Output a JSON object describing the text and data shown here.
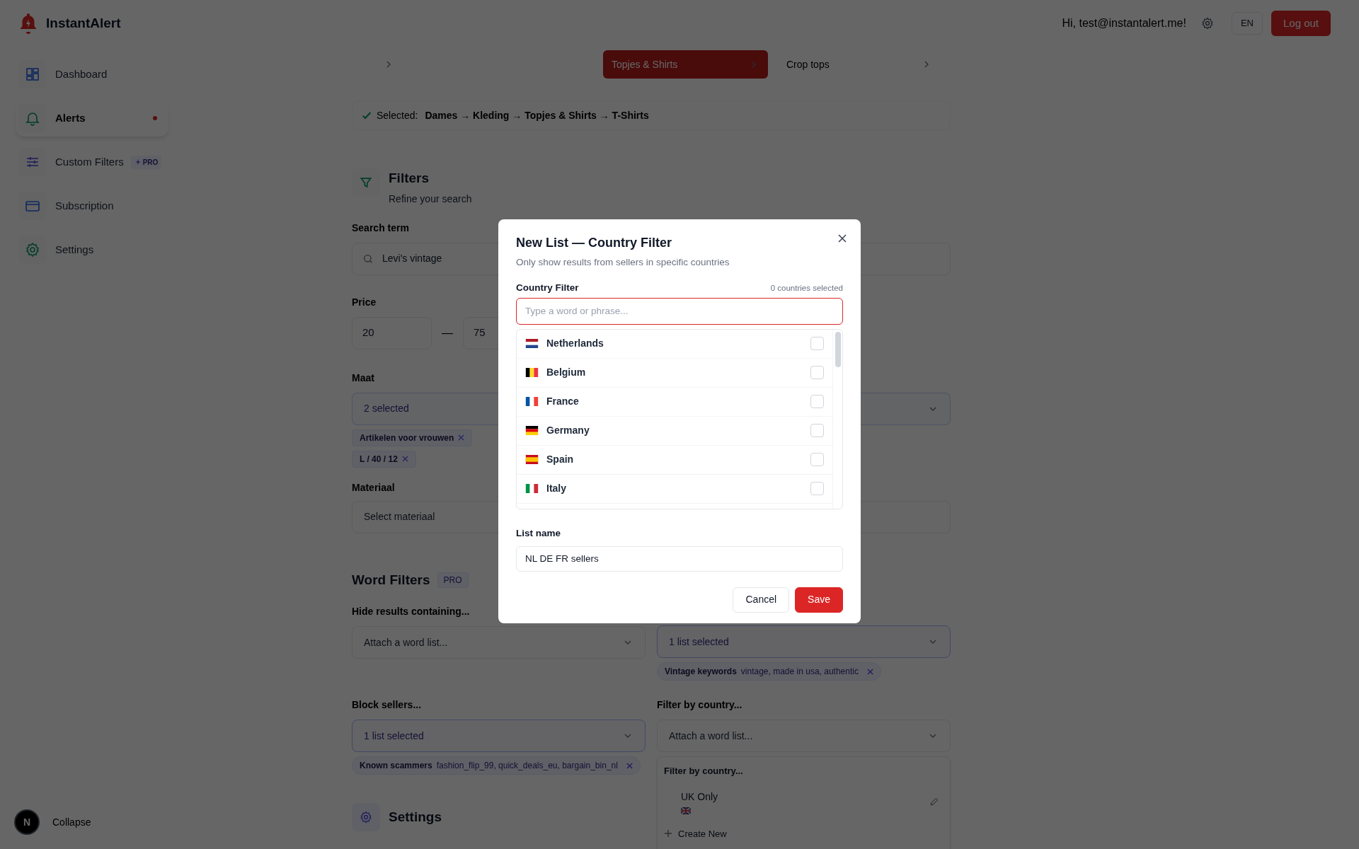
{
  "app": {
    "name": "InstantAlert"
  },
  "header": {
    "greeting": "Hi, test@instantalert.me!",
    "language": "EN",
    "logout": "Log out"
  },
  "sidebar": {
    "items": [
      {
        "label": "Dashboard",
        "selected": false,
        "dot": false
      },
      {
        "label": "Alerts",
        "selected": true,
        "dot": true
      },
      {
        "label": "Custom Filters",
        "selected": false,
        "dot": false,
        "badge": "PRO"
      },
      {
        "label": "Subscription",
        "selected": false,
        "dot": false
      },
      {
        "label": "Settings",
        "selected": false,
        "dot": false
      }
    ],
    "avatar": "N",
    "collapse": "Collapse"
  },
  "category_columns": [
    {
      "selected": false
    },
    {
      "label": "Topjes & Shirts",
      "selected": true
    },
    {
      "label": "Crop tops",
      "selected": false
    }
  ],
  "selected_path": {
    "label": "Selected:",
    "path": "Dames → Kleding → Topjes & Shirts → T-Shirts"
  },
  "filters": {
    "title": "Filters",
    "subtitle": "Refine your search",
    "search_term": {
      "label": "Search term",
      "value": "Levi's vintage"
    },
    "price": {
      "label": "Price",
      "min": "20",
      "separator": "—",
      "max": "75"
    },
    "maat": {
      "label": "Maat",
      "value": "2 selected",
      "chips": [
        "Artikelen voor vrouwen",
        "L / 40 / 12"
      ]
    },
    "materiaal": {
      "label": "Materiaal",
      "placeholder": "Select materiaal"
    }
  },
  "word_filters": {
    "title": "Word Filters",
    "badge": "PRO",
    "fields": [
      {
        "label": "Hide results containing...",
        "placeholder": "Attach a word list..."
      },
      {
        "value": "1 list selected",
        "chips": [
          {
            "name": "Vintage keywords",
            "words": "vintage, made in usa, authentic"
          }
        ]
      },
      {
        "label": "Block sellers...",
        "value": "1 list selected",
        "chips": [
          {
            "name": "Known scammers",
            "words": "fashion_flip_99, quick_deals_eu, bargain_bin_nl"
          }
        ]
      },
      {
        "label": "Filter by country...",
        "placeholder": "Attach a word list...",
        "menu": {
          "heading": "Filter by country...",
          "options": [
            {
              "name": "UK Only"
            }
          ],
          "create": "Create New"
        }
      }
    ]
  },
  "settings_section": {
    "title": "Settings"
  },
  "modal": {
    "title": "New List — Country Filter",
    "subtitle": "Only show results from sellers in specific countries",
    "field_label": "Country Filter",
    "count": "0 countries selected",
    "placeholder": "Type a word or phrase...",
    "countries": [
      {
        "name": "Netherlands",
        "checked": false
      },
      {
        "name": "Belgium",
        "checked": false
      },
      {
        "name": "France",
        "checked": false
      },
      {
        "name": "Germany",
        "checked": false
      },
      {
        "name": "Spain",
        "checked": false
      },
      {
        "name": "Italy",
        "checked": false
      }
    ],
    "list_name_label": "List name",
    "list_name": "NL DE FR sellers",
    "buttons": [
      {
        "label": "Cancel",
        "kind": "secondary"
      },
      {
        "label": "Save",
        "kind": "primary"
      }
    ]
  }
}
